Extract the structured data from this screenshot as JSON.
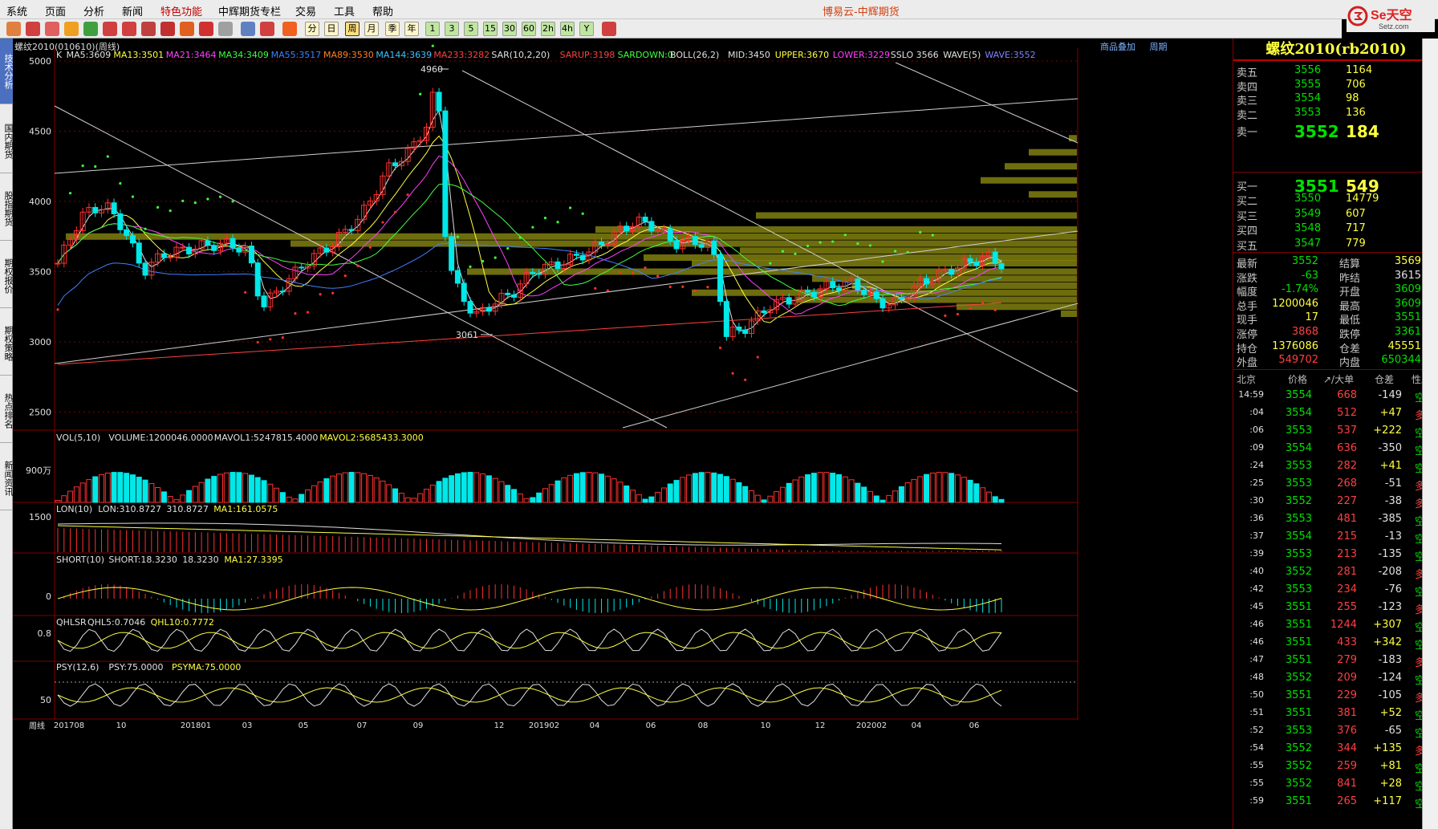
{
  "menu": [
    "系统",
    "页面",
    "分析",
    "新闻",
    "特色功能",
    "中辉期货专栏",
    "交易",
    "工具",
    "帮助"
  ],
  "app_title": "博易云-中辉期货",
  "logo_text": "Se天空",
  "logo_sub": "Setz.com",
  "toolbar_labels": [
    "分",
    "日",
    "周",
    "月",
    "季",
    "年",
    "1",
    "3",
    "5",
    "15",
    "30",
    "60",
    "2h",
    "4h",
    "Y"
  ],
  "sidebar_tabs": [
    {
      "label": "技术分析",
      "active": true
    },
    {
      "label": "国内期货",
      "active": false
    },
    {
      "label": "股指期货",
      "active": false
    },
    {
      "label": "期权报价",
      "active": false
    },
    {
      "label": "期权策略",
      "active": false
    },
    {
      "label": "热点排名",
      "active": false
    },
    {
      "label": "新闻资讯",
      "active": false
    }
  ],
  "chart": {
    "symbol_label": "螺纹2010(010610)(周线)",
    "toolbar_links": [
      "商品叠加",
      "周期"
    ],
    "main_indicators": [
      {
        "text": "K",
        "color": "#e0e0e0"
      },
      {
        "text": "MA5:3609",
        "color": "#e0e0e0"
      },
      {
        "text": "MA13:3501",
        "color": "#ffff40"
      },
      {
        "text": "MA21:3464",
        "color": "#ff40ff"
      },
      {
        "text": "MA34:3409",
        "color": "#40ff40"
      },
      {
        "text": "MA55:3517",
        "color": "#4080ff"
      },
      {
        "text": "MA89:3530",
        "color": "#ff8020"
      },
      {
        "text": "MA144:3639",
        "color": "#40c0ff"
      },
      {
        "text": "MA233:3282",
        "color": "#ff4040"
      },
      {
        "text": "SAR(10,2,20)",
        "color": "#e0e0e0"
      },
      {
        "text": "SARUP:3198",
        "color": "#ff4040"
      },
      {
        "text": "SARDOWN:0",
        "color": "#40ff40"
      },
      {
        "text": "BOLL(26,2)",
        "color": "#e0e0e0"
      },
      {
        "text": "MID:3450",
        "color": "#e0e0e0"
      },
      {
        "text": "UPPER:3670",
        "color": "#ffff40"
      },
      {
        "text": "LOWER:3229",
        "color": "#ff40ff"
      },
      {
        "text": "SSLO 3566",
        "color": "#e0e0e0"
      },
      {
        "text": "WAVE(5)",
        "color": "#e0e0e0"
      },
      {
        "text": "WAVE:3552",
        "color": "#8080ff"
      }
    ],
    "price_axis": [
      "5000",
      "4500",
      "4000",
      "3500",
      "3000",
      "2500"
    ],
    "high_label": "4960",
    "low_label": "3061",
    "vol_indicators": [
      {
        "text": "VOL(5,10)",
        "color": "#e0e0e0"
      },
      {
        "text": "VOLUME:1200046.0000",
        "color": "#e0e0e0"
      },
      {
        "text": "MAVOL1:5247815.4000",
        "color": "#e0e0e0"
      },
      {
        "text": "MAVOL2:5685433.3000",
        "color": "#ffff40"
      }
    ],
    "vol_axis": "900万",
    "lon_indicators": [
      {
        "text": "LON(10)",
        "color": "#e0e0e0"
      },
      {
        "text": "LON:310.8727",
        "color": "#e0e0e0"
      },
      {
        "text": "310.8727",
        "color": "#e0e0e0"
      },
      {
        "text": "MA1:161.0575",
        "color": "#ffff40"
      }
    ],
    "lon_axis": "1500",
    "short_indicators": [
      {
        "text": "SHORT(10)",
        "color": "#e0e0e0"
      },
      {
        "text": "SHORT:18.3230",
        "color": "#e0e0e0"
      },
      {
        "text": "18.3230",
        "color": "#e0e0e0"
      },
      {
        "text": "MA1:27.3395",
        "color": "#ffff40"
      }
    ],
    "short_axis": "0",
    "qhl_indicators": [
      {
        "text": "QHLSR",
        "color": "#e0e0e0"
      },
      {
        "text": "QHL5:0.7046",
        "color": "#e0e0e0"
      },
      {
        "text": "QHL10:0.7772",
        "color": "#ffff40"
      }
    ],
    "qhl_axis": "0.8",
    "psy_indicators": [
      {
        "text": "PSY(12,6)",
        "color": "#e0e0e0"
      },
      {
        "text": "PSY:75.0000",
        "color": "#e0e0e0"
      },
      {
        "text": "PSYMA:75.0000",
        "color": "#ffff40"
      }
    ],
    "psy_axis": "50",
    "period_label": "周线",
    "date_axis": [
      "201708",
      "10",
      "201801",
      "03",
      "05",
      "07",
      "09",
      "12",
      "201902",
      "04",
      "06",
      "08",
      "10",
      "12",
      "202002",
      "04",
      "06"
    ]
  },
  "quote": {
    "title": "螺纹2010(rb2010)",
    "asks": [
      {
        "label": "卖五",
        "price": "3556",
        "vol": "1164"
      },
      {
        "label": "卖四",
        "price": "3555",
        "vol": "706"
      },
      {
        "label": "卖三",
        "price": "3554",
        "vol": "98"
      },
      {
        "label": "卖二",
        "price": "3553",
        "vol": "136"
      },
      {
        "label": "卖一",
        "price": "3552",
        "vol": "184"
      }
    ],
    "bids": [
      {
        "label": "买一",
        "price": "3551",
        "vol": "549"
      },
      {
        "label": "买二",
        "price": "3550",
        "vol": "14779"
      },
      {
        "label": "买三",
        "price": "3549",
        "vol": "607"
      },
      {
        "label": "买四",
        "price": "3548",
        "vol": "717"
      },
      {
        "label": "买五",
        "price": "3547",
        "vol": "779"
      }
    ],
    "stats": [
      [
        {
          "l": "最新",
          "v": "3552",
          "c": "g"
        },
        {
          "l": "结算",
          "v": "3569",
          "c": "y"
        }
      ],
      [
        {
          "l": "涨跌",
          "v": "-63",
          "c": "g"
        },
        {
          "l": "昨结",
          "v": "3615",
          "c": "w"
        }
      ],
      [
        {
          "l": "幅度",
          "v": "-1.74%",
          "c": "g"
        },
        {
          "l": "开盘",
          "v": "3609",
          "c": "g"
        }
      ],
      [
        {
          "l": "总手",
          "v": "1200046",
          "c": "y"
        },
        {
          "l": "最高",
          "v": "3609",
          "c": "g"
        }
      ],
      [
        {
          "l": "现手",
          "v": "17",
          "c": "y"
        },
        {
          "l": "最低",
          "v": "3551",
          "c": "g"
        }
      ],
      [
        {
          "l": "涨停",
          "v": "3868",
          "c": "r"
        },
        {
          "l": "跌停",
          "v": "3361",
          "c": "g"
        }
      ],
      [
        {
          "l": "持仓",
          "v": "1376086",
          "c": "y"
        },
        {
          "l": "仓差",
          "v": "45551",
          "c": "y"
        }
      ],
      [
        {
          "l": "外盘",
          "v": "549702",
          "c": "r"
        },
        {
          "l": "内盘",
          "v": "650344",
          "c": "g"
        }
      ]
    ],
    "tick_header": [
      "北京",
      "价格",
      "↗/大单",
      "仓差",
      "性质"
    ],
    "ticks": [
      {
        "t": "14:59",
        "p": "3554",
        "v": "668",
        "c": "-149",
        "k": "空平"
      },
      {
        "t": ":04",
        "p": "3554",
        "v": "512",
        "c": "+47",
        "k": "多开"
      },
      {
        "t": ":06",
        "p": "3553",
        "v": "537",
        "c": "+222",
        "k": "空开"
      },
      {
        "t": ":09",
        "p": "3554",
        "v": "636",
        "c": "-350",
        "k": "空平"
      },
      {
        "t": ":24",
        "p": "3553",
        "v": "282",
        "c": "+41",
        "k": "空开"
      },
      {
        "t": ":25",
        "p": "3553",
        "v": "268",
        "c": "-51",
        "k": "多平"
      },
      {
        "t": ":30",
        "p": "3552",
        "v": "227",
        "c": "-38",
        "k": "多平"
      },
      {
        "t": ":36",
        "p": "3553",
        "v": "481",
        "c": "-385",
        "k": "空平"
      },
      {
        "t": ":37",
        "p": "3554",
        "v": "215",
        "c": "-13",
        "k": "空平"
      },
      {
        "t": ":39",
        "p": "3553",
        "v": "213",
        "c": "-135",
        "k": "空平"
      },
      {
        "t": ":40",
        "p": "3552",
        "v": "281",
        "c": "-208",
        "k": "多平"
      },
      {
        "t": ":42",
        "p": "3553",
        "v": "234",
        "c": "-76",
        "k": "空平"
      },
      {
        "t": ":45",
        "p": "3551",
        "v": "255",
        "c": "-123",
        "k": "多平"
      },
      {
        "t": ":46",
        "p": "3551",
        "v": "1244",
        "c": "+307",
        "k": "空开"
      },
      {
        "t": ":46",
        "p": "3551",
        "v": "433",
        "c": "+342",
        "k": "空开"
      },
      {
        "t": ":47",
        "p": "3551",
        "v": "279",
        "c": "-183",
        "k": "多平"
      },
      {
        "t": ":48",
        "p": "3552",
        "v": "209",
        "c": "-124",
        "k": "空平"
      },
      {
        "t": ":50",
        "p": "3551",
        "v": "229",
        "c": "-105",
        "k": "多平"
      },
      {
        "t": ":51",
        "p": "3551",
        "v": "381",
        "c": "+52",
        "k": "空开"
      },
      {
        "t": ":52",
        "p": "3553",
        "v": "376",
        "c": "-65",
        "k": "空平"
      },
      {
        "t": ":54",
        "p": "3552",
        "v": "344",
        "c": "+135",
        "k": "多开"
      },
      {
        "t": ":55",
        "p": "3552",
        "v": "259",
        "c": "+81",
        "k": "空开"
      },
      {
        "t": ":55",
        "p": "3552",
        "v": "841",
        "c": "+28",
        "k": "空开"
      },
      {
        "t": ":59",
        "p": "3551",
        "v": "265",
        "c": "+117",
        "k": "空开"
      }
    ]
  },
  "colors": {
    "up": "#ff3030",
    "down": "#00e8e8",
    "grid": "#800000",
    "ma5": "#e0e0e0",
    "ma13": "#ffff40",
    "ma21": "#ff40ff",
    "ma34": "#40ff40",
    "ma55": "#4080ff",
    "ma233": "#ff4040",
    "volume_profile": "#808010"
  }
}
